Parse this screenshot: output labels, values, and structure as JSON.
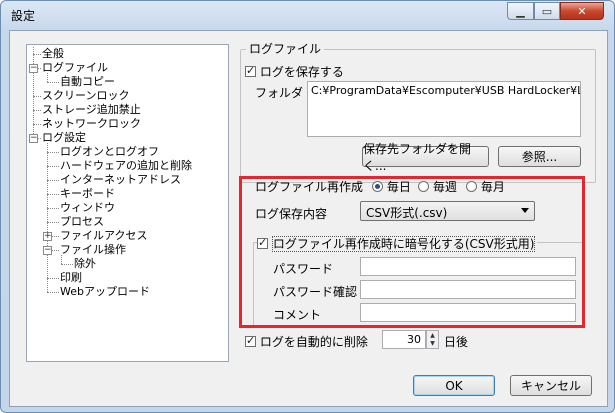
{
  "window": {
    "title": "設定"
  },
  "tree": {
    "items": [
      {
        "label": "全般"
      },
      {
        "label": "ログファイル"
      },
      {
        "label": "自動コピー"
      },
      {
        "label": "スクリーンロック"
      },
      {
        "label": "ストレージ追加禁止"
      },
      {
        "label": "ネットワークロック"
      },
      {
        "label": "ログ設定"
      },
      {
        "label": "ログオンとログオフ"
      },
      {
        "label": "ハードウェアの追加と削除"
      },
      {
        "label": "インターネットアドレス"
      },
      {
        "label": "キーボード"
      },
      {
        "label": "ウィンドウ"
      },
      {
        "label": "プロセス"
      },
      {
        "label": "ファイルアクセス"
      },
      {
        "label": "ファイル操作"
      },
      {
        "label": "除外"
      },
      {
        "label": "印刷"
      },
      {
        "label": "Webアップロード"
      }
    ]
  },
  "logfile": {
    "group_title": "ログファイル",
    "save_log_label": "ログを保存する",
    "save_log_checked": true,
    "folder_label": "フォルダ",
    "folder_path": "C:¥ProgramData¥Escomputer¥USB HardLocker¥Log",
    "open_folder_button": "保存先フォルダを開く...",
    "browse_button": "参照..."
  },
  "recreate": {
    "label": "ログファイル再作成",
    "options": [
      {
        "label": "毎日",
        "selected": true
      },
      {
        "label": "毎週",
        "selected": false
      },
      {
        "label": "毎月",
        "selected": false
      }
    ]
  },
  "content": {
    "label": "ログ保存内容",
    "selected": "CSV形式(.csv)"
  },
  "encrypt": {
    "label": "ログファイル再作成時に暗号化する(CSV形式用)",
    "checked": true,
    "password_label": "パスワード",
    "password_confirm_label": "パスワード確認",
    "comment_label": "コメント"
  },
  "autodelete": {
    "label": "ログを自動的に削除",
    "checked": true,
    "days": "30",
    "suffix": "日後"
  },
  "buttons": {
    "ok": "OK",
    "cancel": "キャンセル"
  }
}
